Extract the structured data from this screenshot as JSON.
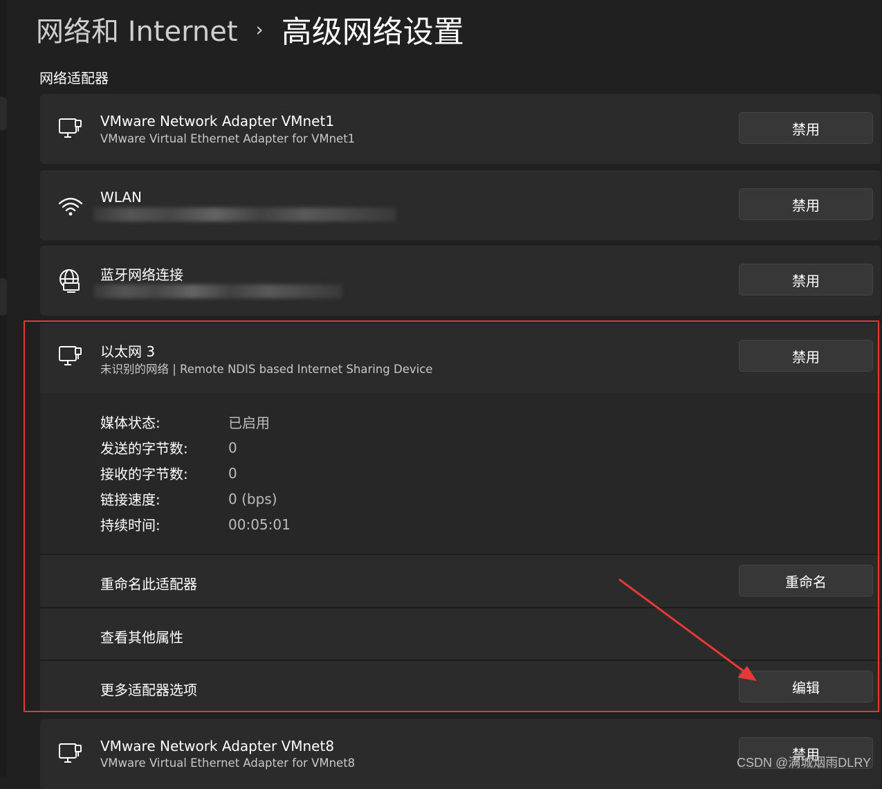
{
  "breadcrumb": {
    "parent": "网络和 Internet",
    "separator": "›",
    "current": "高级网络设置"
  },
  "section_title": "网络适配器",
  "adapters": [
    {
      "name": "VMware Network Adapter VMnet1",
      "description": "VMware Virtual Ethernet Adapter for VMnet1",
      "button": "禁用",
      "icon": "ethernet-icon"
    },
    {
      "name": "WLAN",
      "description": "",
      "button": "禁用",
      "icon": "wifi-icon"
    },
    {
      "name": "蓝牙网络连接",
      "description": "",
      "button": "禁用",
      "icon": "globe-network-icon"
    },
    {
      "name": "以太网 3",
      "description": "未识别的网络 | Remote NDIS based Internet Sharing Device",
      "button": "禁用",
      "icon": "ethernet-icon"
    },
    {
      "name": "VMware Network Adapter VMnet8",
      "description": "VMware Virtual Ethernet Adapter for VMnet8",
      "button": "禁用",
      "icon": "ethernet-icon"
    }
  ],
  "expanded": {
    "properties": [
      {
        "label": "媒体状态:",
        "value": "已启用"
      },
      {
        "label": "发送的字节数:",
        "value": "0"
      },
      {
        "label": "接收的字节数:",
        "value": "0"
      },
      {
        "label": "链接速度:",
        "value": "0 (bps)"
      },
      {
        "label": "持续时间:",
        "value": "00:05:01"
      }
    ],
    "rename": {
      "label": "重命名此适配器",
      "button": "重命名"
    },
    "view_properties": {
      "label": "查看其他属性"
    },
    "more_options": {
      "label": "更多适配器选项",
      "button": "编辑"
    }
  },
  "annotation": {
    "highlight_color": "#e53935"
  },
  "watermark": "CSDN @满城烟雨DLRY",
  "colors": {
    "background": "#202020",
    "card": "#2b2b2b",
    "button": "#373737"
  }
}
